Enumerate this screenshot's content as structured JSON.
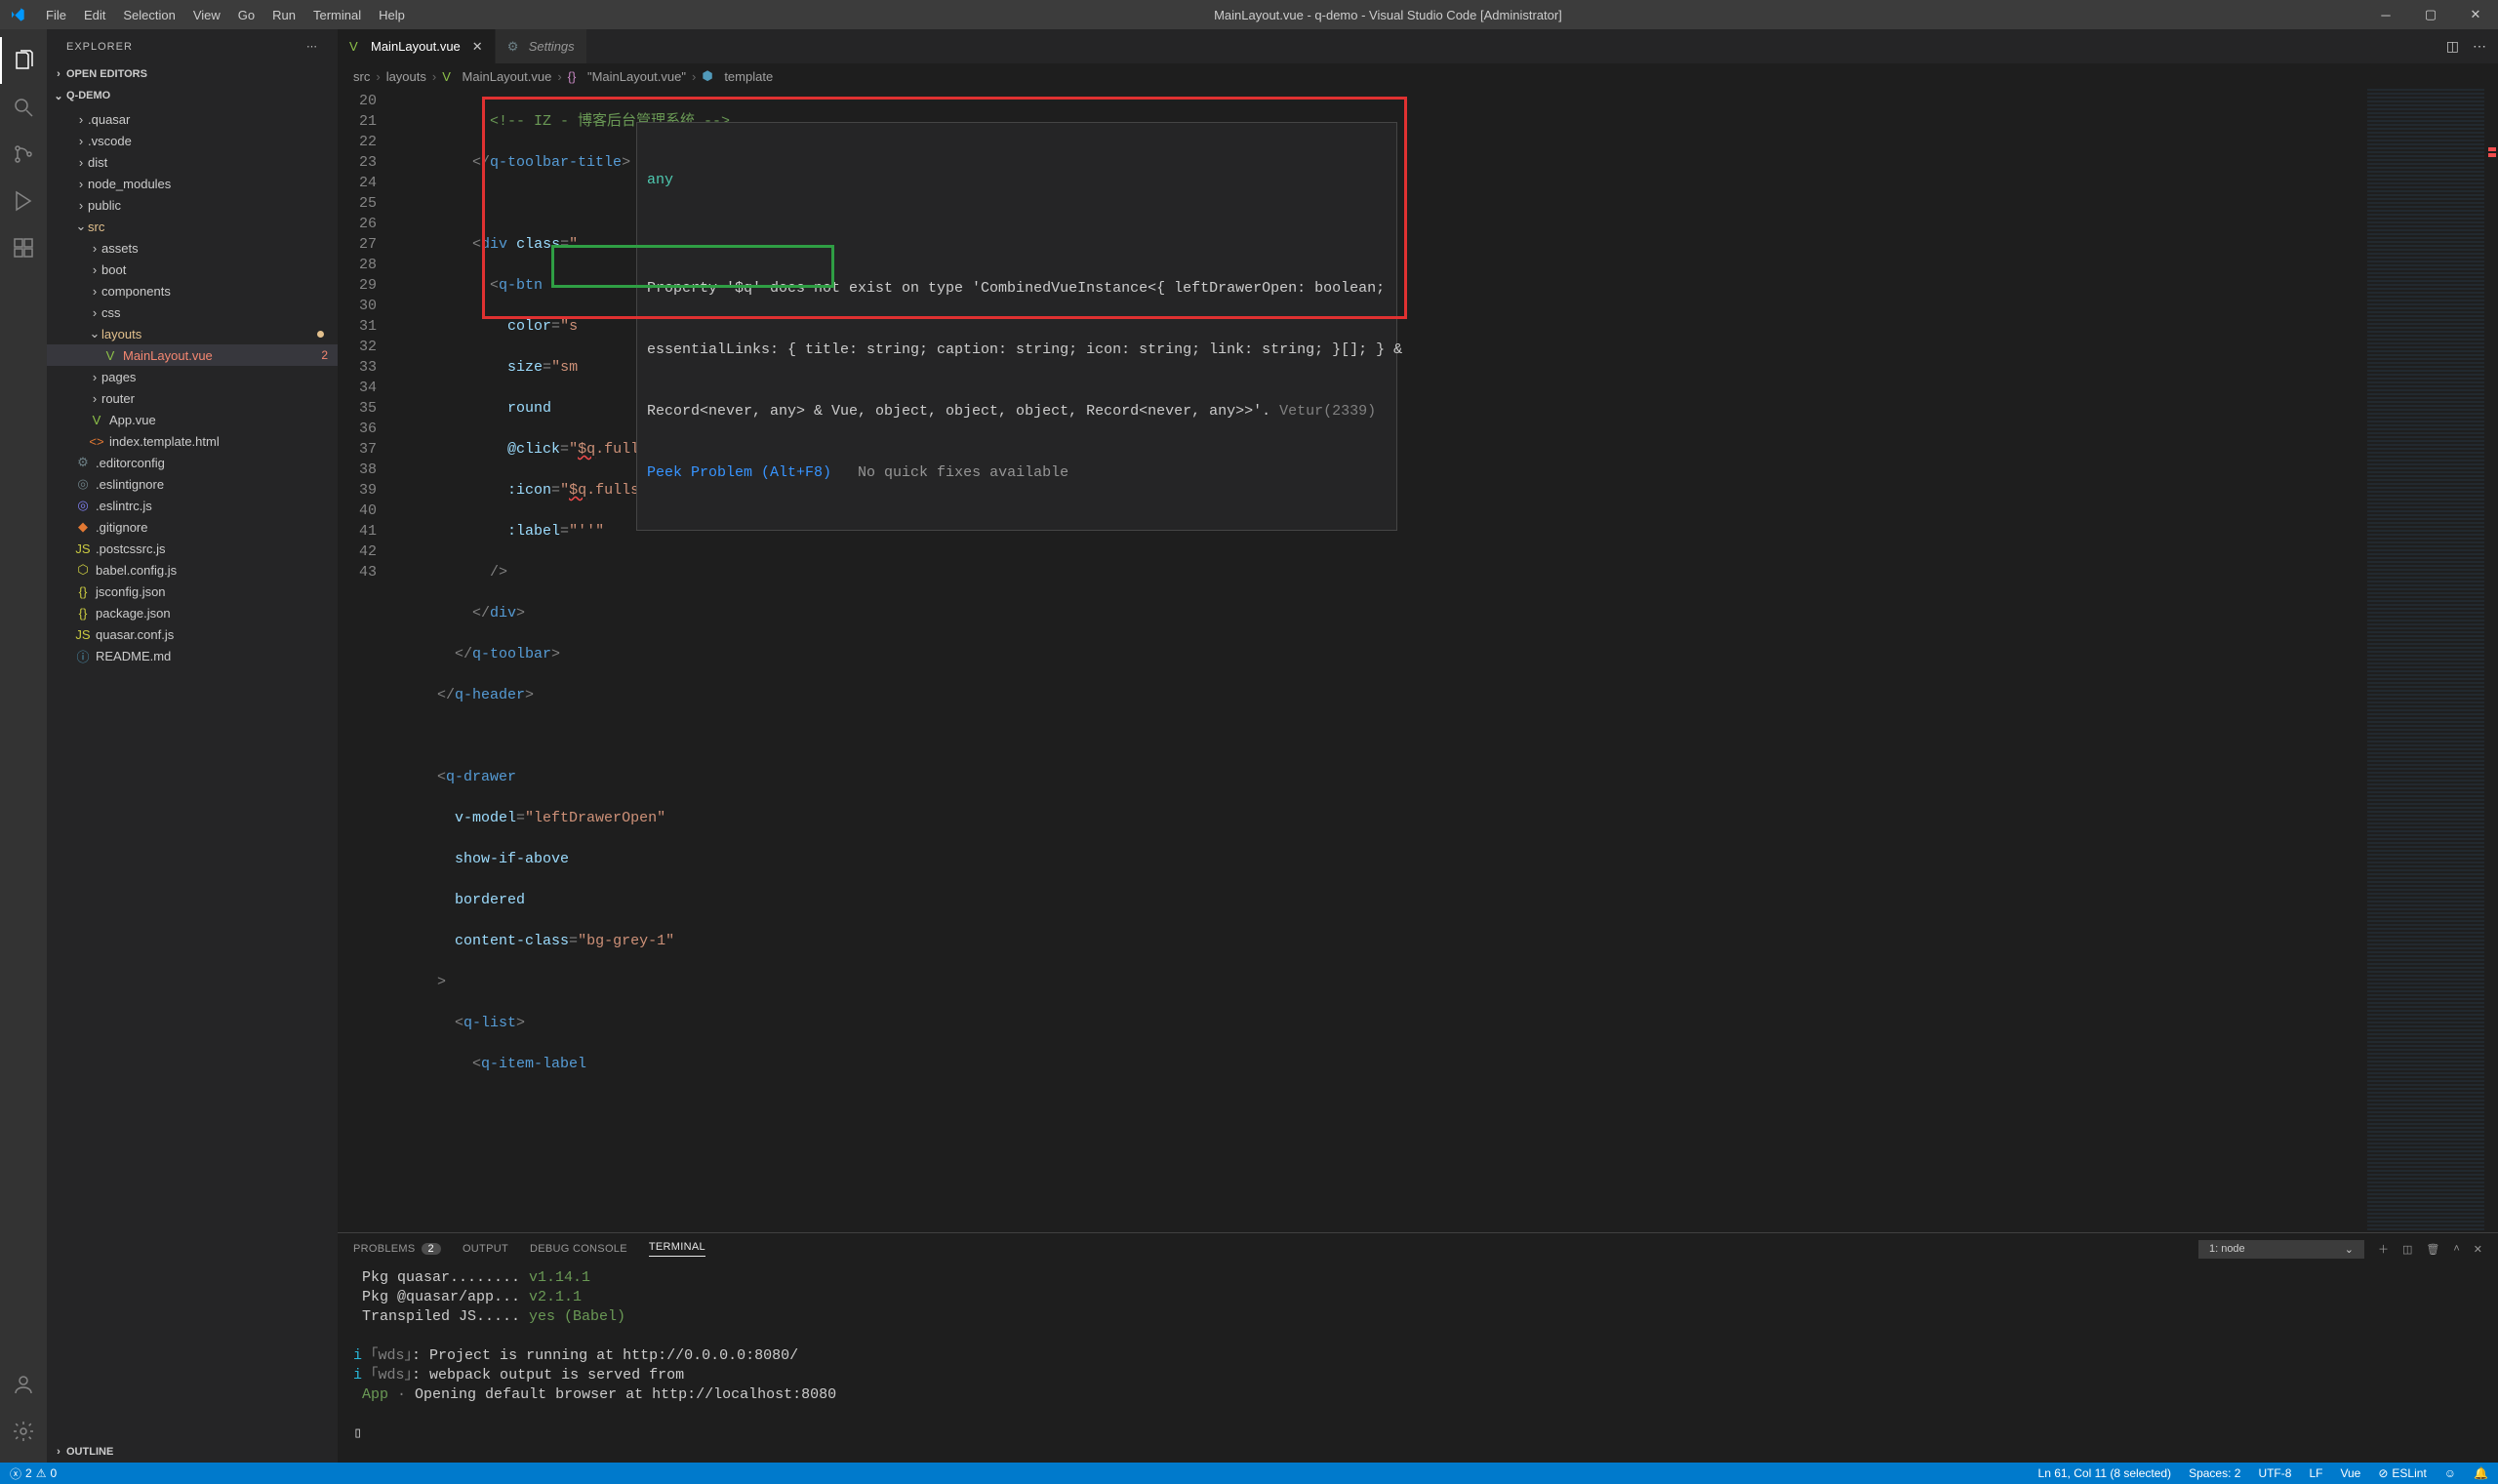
{
  "title": "MainLayout.vue - q-demo - Visual Studio Code [Administrator]",
  "menu": [
    "File",
    "Edit",
    "Selection",
    "View",
    "Go",
    "Run",
    "Terminal",
    "Help"
  ],
  "explorer": {
    "title": "EXPLORER",
    "sections": {
      "openEditors": "OPEN EDITORS",
      "project": "Q-DEMO",
      "outline": "OUTLINE"
    }
  },
  "tree": {
    "quasar": ".quasar",
    "vscode": ".vscode",
    "dist": "dist",
    "node_modules": "node_modules",
    "public": "public",
    "src": "src",
    "assets": "assets",
    "boot": "boot",
    "components": "components",
    "css": "css",
    "layouts": "layouts",
    "mainlayout": "MainLayout.vue",
    "mainlayout_err": "2",
    "pages": "pages",
    "router": "router",
    "appvue": "App.vue",
    "indexhtml": "index.template.html",
    "editorconfig": ".editorconfig",
    "eslintignore": ".eslintignore",
    "eslintrc": ".eslintrc.js",
    "gitignore": ".gitignore",
    "postcssrc": ".postcssrc.js",
    "babel": "babel.config.js",
    "jsconfig": "jsconfig.json",
    "package": "package.json",
    "quasarconf": "quasar.conf.js",
    "readme": "README.md"
  },
  "tabs": {
    "main": "MainLayout.vue",
    "settings": "Settings"
  },
  "breadcrumbs": [
    "src",
    "layouts",
    "MainLayout.vue",
    "\"MainLayout.vue\"",
    "template"
  ],
  "lineStart": 20,
  "lineEnd": 43,
  "hover": {
    "type": "any",
    "msg1": "Property '$q' does not exist on type 'CombinedVueInstance<{ leftDrawerOpen: boolean;",
    "msg2": "essentialLinks: { title: string; caption: string; icon: string; link: string; }[]; } &",
    "msg3": "Record<never, any> & Vue, object, object, object, Record<never, any>>'.",
    "vetur": "Vetur(2339)",
    "peek": "Peek Problem (Alt+F8)",
    "nofix": "No quick fixes available"
  },
  "panel": {
    "problems": "PROBLEMS",
    "problems_count": "2",
    "output": "OUTPUT",
    "debug": "DEBUG CONSOLE",
    "terminal": "TERMINAL",
    "termSelect": "1: node"
  },
  "terminal": {
    "l1a": " Pkg quasar........ ",
    "l1b": "v1.14.1",
    "l2a": " Pkg @quasar/app... ",
    "l2b": "v2.1.1",
    "l3a": " Transpiled JS..... ",
    "l3b": "yes (Babel)",
    "l4": "i ｢wds｣: Project is running at http://0.0.0.0:8080/",
    "l5": "i ｢wds｣: webpack output is served from ",
    "l6a": " App · ",
    "l6b": "Opening default browser at http://localhost:8080"
  },
  "status": {
    "errors": "2",
    "warnings": "0",
    "position": "Ln 61, Col 11 (8 selected)",
    "spaces": "Spaces: 2",
    "encoding": "UTF-8",
    "eol": "LF",
    "lang": "Vue",
    "eslint": "ESLint"
  }
}
